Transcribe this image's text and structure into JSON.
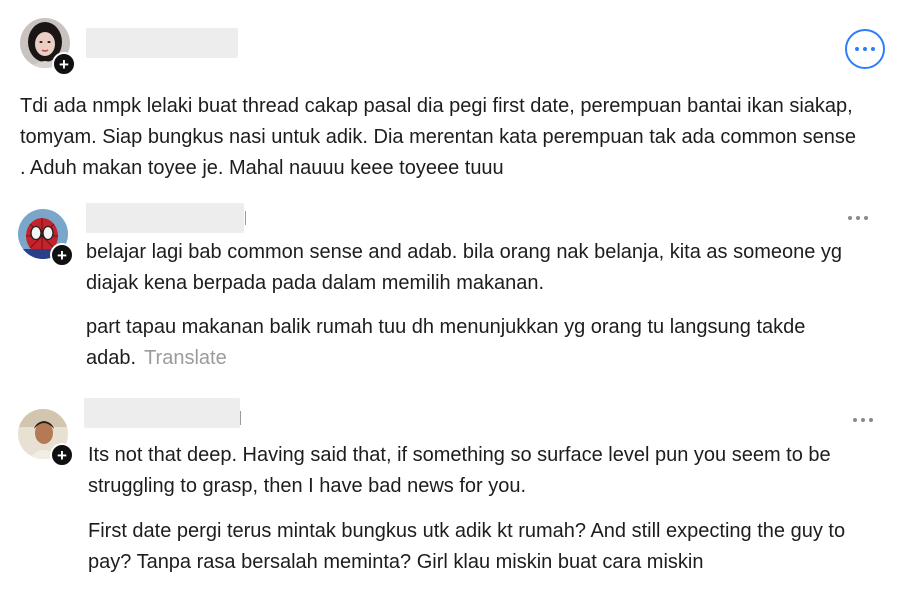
{
  "post": {
    "avatar": "avatar-woman-dark-hair",
    "more_icon": "more-options-icon",
    "follow_icon": "plus-icon",
    "text": "Tdi ada nmpk lelaki buat thread cakap pasal dia pegi first date, perempuan bantai ikan siakap, tomyam. Siap bungkus nasi untuk adik. Dia merentan kata perempuan tak ada common sense . Aduh makan toyee je. Mahal nauuu keee toyeee tuuu"
  },
  "replies": [
    {
      "avatar": "avatar-spiderman",
      "paragraphs": [
        "belajar lagi bab common sense and adab. bila orang nak belanja, kita as someone yg diajak kena berpada pada dalam memilih makanan.",
        "part tapau makanan balik rumah tuu dh menunjukkan yg orang tu langsung takde adab."
      ],
      "translate_label": "Translate"
    },
    {
      "avatar": "avatar-man-portrait",
      "paragraphs": [
        "Its not that deep. Having said that, if something so surface level pun you seem to be struggling to grasp, then I have bad news for you.",
        "First date pergi terus mintak bungkus utk adik kt rumah? And still expecting the guy to pay? Tanpa rasa bersalah meminta? Girl klau miskin buat cara miskin"
      ]
    }
  ],
  "colors": {
    "accent": "#2d7ff9",
    "text": "#1d1d1d",
    "muted": "#9b9b9b"
  }
}
